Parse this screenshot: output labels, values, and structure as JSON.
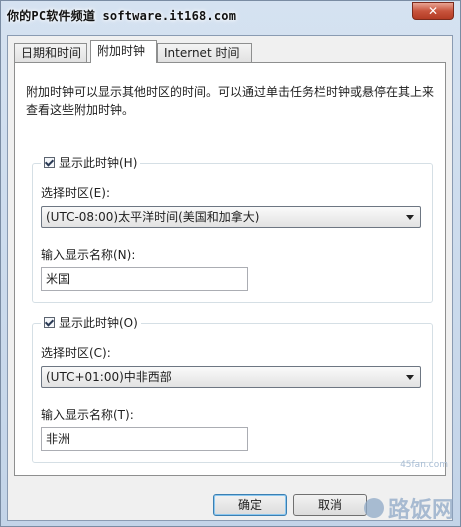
{
  "window": {
    "title": "你的PC软件频道 software.it168.com",
    "close_label": "✕"
  },
  "tabs": [
    {
      "label": "日期和时间"
    },
    {
      "label": "附加时钟"
    },
    {
      "label": "Internet 时间"
    }
  ],
  "description": "附加时钟可以显示其他时区的时间。可以通过单击任务栏时钟或悬停在其上来查看这些附加时钟。",
  "clocks": [
    {
      "checkbox_label": "显示此时钟(H)",
      "checked": true,
      "timezone_label": "选择时区(E):",
      "timezone_value": "(UTC-08:00)太平洋时间(美国和加拿大)",
      "name_label": "输入显示名称(N):",
      "name_value": "米国"
    },
    {
      "checkbox_label": "显示此时钟(O)",
      "checked": true,
      "timezone_label": "选择时区(C):",
      "timezone_value": "(UTC+01:00)中非西部",
      "name_label": "输入显示名称(T):",
      "name_value": "非洲"
    }
  ],
  "buttons": {
    "ok": "确定",
    "cancel": "取消"
  },
  "watermark": {
    "brand": "路饭网",
    "site": "45fan.com"
  }
}
